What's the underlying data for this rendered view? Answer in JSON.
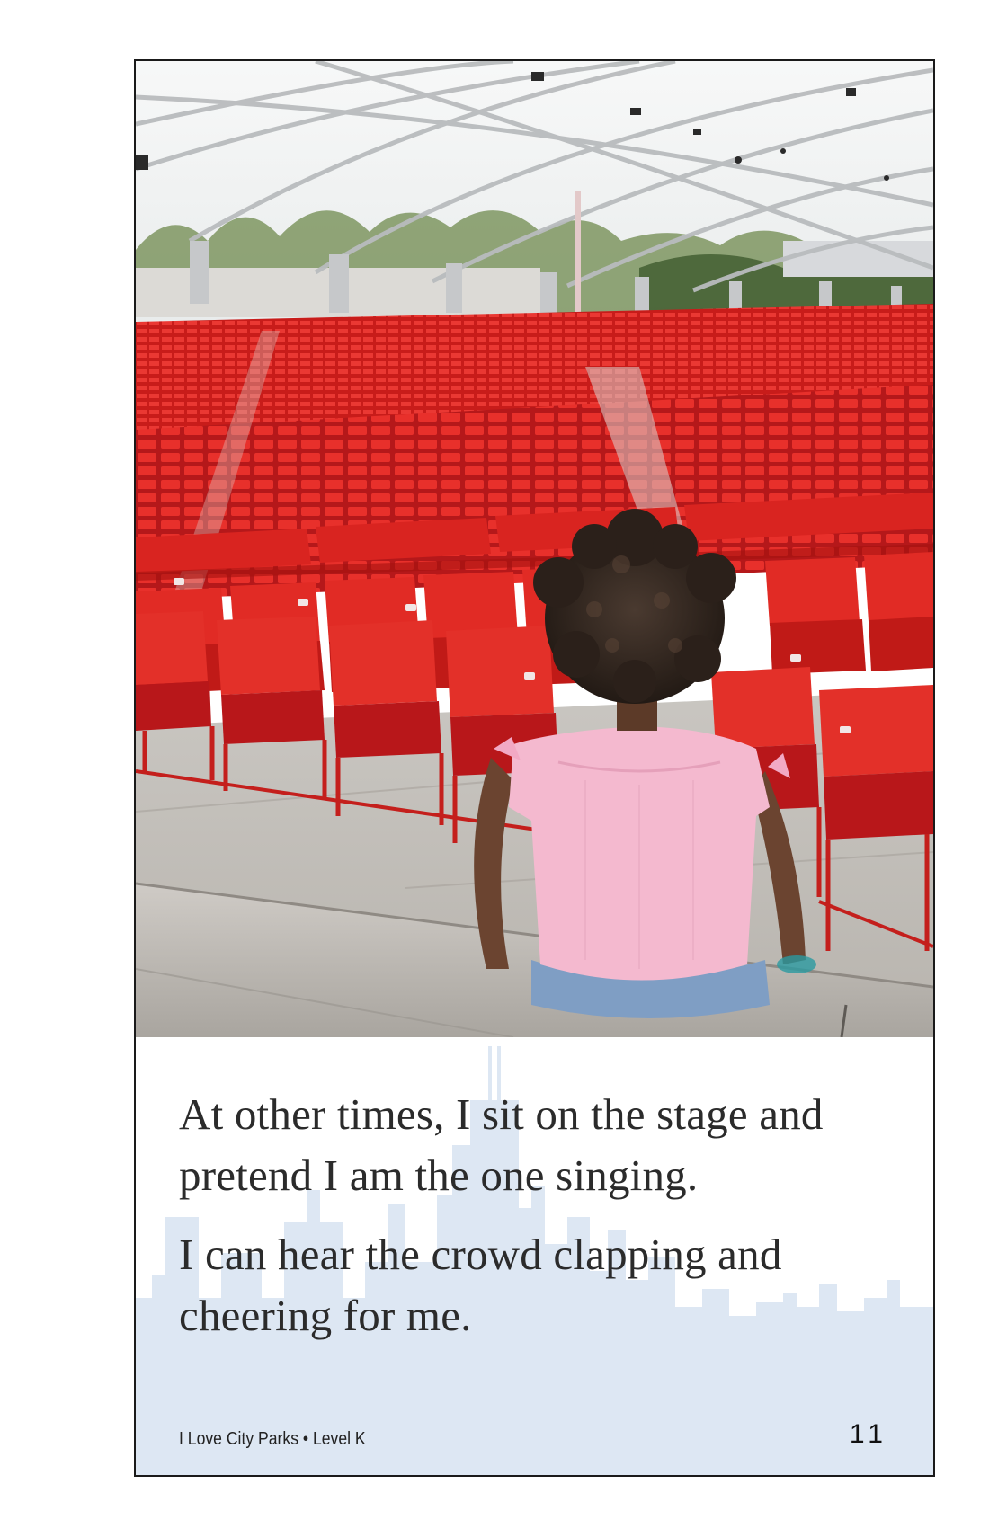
{
  "page": {
    "paragraphs": [
      "At other times, I sit on the stage and pretend I am the one singing.",
      "I can hear the crowd clapping and cheering for me."
    ],
    "footer_title": "I Love City Parks • Level K",
    "page_number": "11"
  },
  "colors": {
    "seat_red": "#e0231f",
    "skyline_blue": "#dde7f3",
    "shirt_pink": "#f4b9cf"
  },
  "icons": {
    "background": "chicago-skyline-silhouette"
  }
}
